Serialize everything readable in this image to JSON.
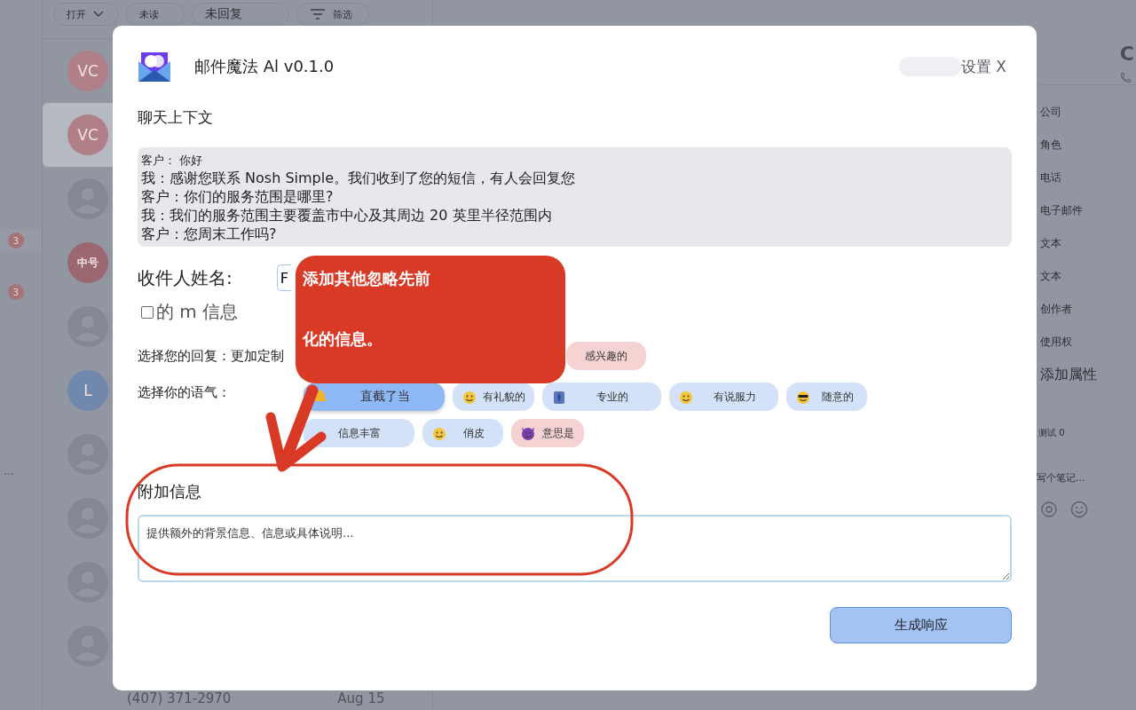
{
  "toolbar": {
    "filters": [
      {
        "label": "打开",
        "kind": "dropdown"
      },
      {
        "label": "未读",
        "kind": "pill"
      },
      {
        "label": "未回复",
        "kind": "pill"
      },
      {
        "label": "筛选",
        "kind": "filter"
      }
    ]
  },
  "rail": {
    "badges": [
      "3",
      "3"
    ],
    "more": "..."
  },
  "contacts": [
    {
      "kind": "initials",
      "initials": "VC",
      "color": "#b07f87",
      "selected": false
    },
    {
      "kind": "initials",
      "initials": "VC",
      "color": "#b07f87",
      "selected": true
    },
    {
      "kind": "placeholder",
      "selected": false
    },
    {
      "kind": "initials",
      "initials": "中号",
      "color": "#9b6771",
      "selected": false
    },
    {
      "kind": "placeholder",
      "selected": false
    },
    {
      "kind": "initials",
      "initials": "L",
      "color": "#6f88ab",
      "selected": false
    },
    {
      "kind": "placeholder",
      "selected": false
    },
    {
      "kind": "placeholder",
      "selected": false
    },
    {
      "kind": "placeholder",
      "selected": false
    },
    {
      "kind": "placeholder",
      "selected": false
    }
  ],
  "last_contact": {
    "phone": "(407) 371-2970",
    "date": "Aug 15"
  },
  "right_panel": {
    "header": "C",
    "properties": [
      "公司",
      "角色",
      "电话",
      "电子邮件",
      "文本",
      "文本",
      "创作者",
      "使用权"
    ],
    "add_property": "添加属性",
    "counter": "测试 0",
    "note_placeholder": "写个笔记..."
  },
  "modal": {
    "title": "邮件魔法 Al v0.1.0",
    "settings": "设置 X",
    "context_label": "聊天上下文",
    "chat": [
      {
        "text": "客户： 你好",
        "kind": "small"
      },
      {
        "text": "我：感谢您联系 Nosh Simple。我们收到了您的短信，有人会回复您",
        "kind": "normal"
      },
      {
        "text": "客户：你们的服务范围是哪里?",
        "kind": "normal"
      },
      {
        "text": "我：我们的服务范围主要覆盖市中心及其周边 20 英里半径范围内",
        "kind": "normal"
      },
      {
        "text": "客户：您周末工作吗?",
        "kind": "normal"
      }
    ],
    "recipient_label": "收件人姓名:",
    "recipient_value": "F",
    "checkbox": {
      "label": "的 m 信息",
      "checked": false
    },
    "reply_label": "选择您的回复：更加定制",
    "replies": [
      {
        "label": "感兴趣的",
        "kind": "negative",
        "selected": false
      }
    ],
    "tone_label": "选择你的语气：",
    "tones": [
      {
        "label": "直截了当",
        "kind": "neutral",
        "selected": true
      },
      {
        "label": "有礼貌的",
        "kind": "neutral",
        "selected": false
      },
      {
        "label": "专业的",
        "kind": "neutral",
        "selected": false
      },
      {
        "label": "有说服力",
        "kind": "neutral",
        "selected": false
      },
      {
        "label": "随意的",
        "kind": "neutral",
        "selected": false
      },
      {
        "label": "信息丰富",
        "kind": "neutral",
        "selected": false
      },
      {
        "label": "俏皮",
        "kind": "neutral",
        "selected": false
      },
      {
        "label": "意思是",
        "kind": "negative",
        "selected": false
      }
    ],
    "extra_label": "附加信息",
    "extra_placeholder": "提供额外的背景信息、信息或具体说明...",
    "generate": "生成响应"
  },
  "annotation": {
    "callout": [
      "添加其他忽略先前",
      "化的信息。"
    ]
  }
}
